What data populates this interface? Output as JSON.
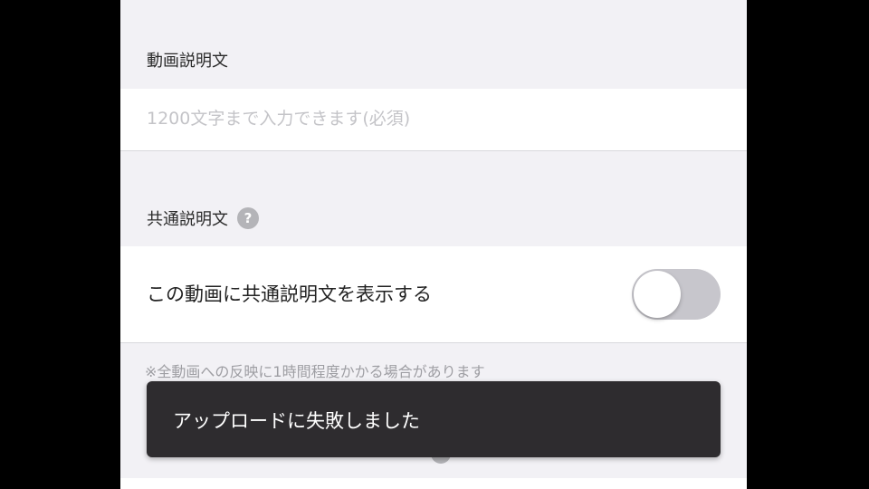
{
  "video_description": {
    "label": "動画説明文",
    "placeholder": "1200文字まで入力できます(必須)",
    "value": ""
  },
  "common_description": {
    "label": "共通説明文",
    "help_icon": "?",
    "toggle_label": "この動画に共通説明文を表示する",
    "toggle_on": false,
    "note": "※全動画への反映に1時間程度かかる場合があります"
  },
  "toast": {
    "message": "アップロードに失敗しました"
  },
  "colors": {
    "background": "#f2f1f5",
    "toggle_off": "#c7c6cc",
    "toast_bg": "#2e2c2f"
  }
}
